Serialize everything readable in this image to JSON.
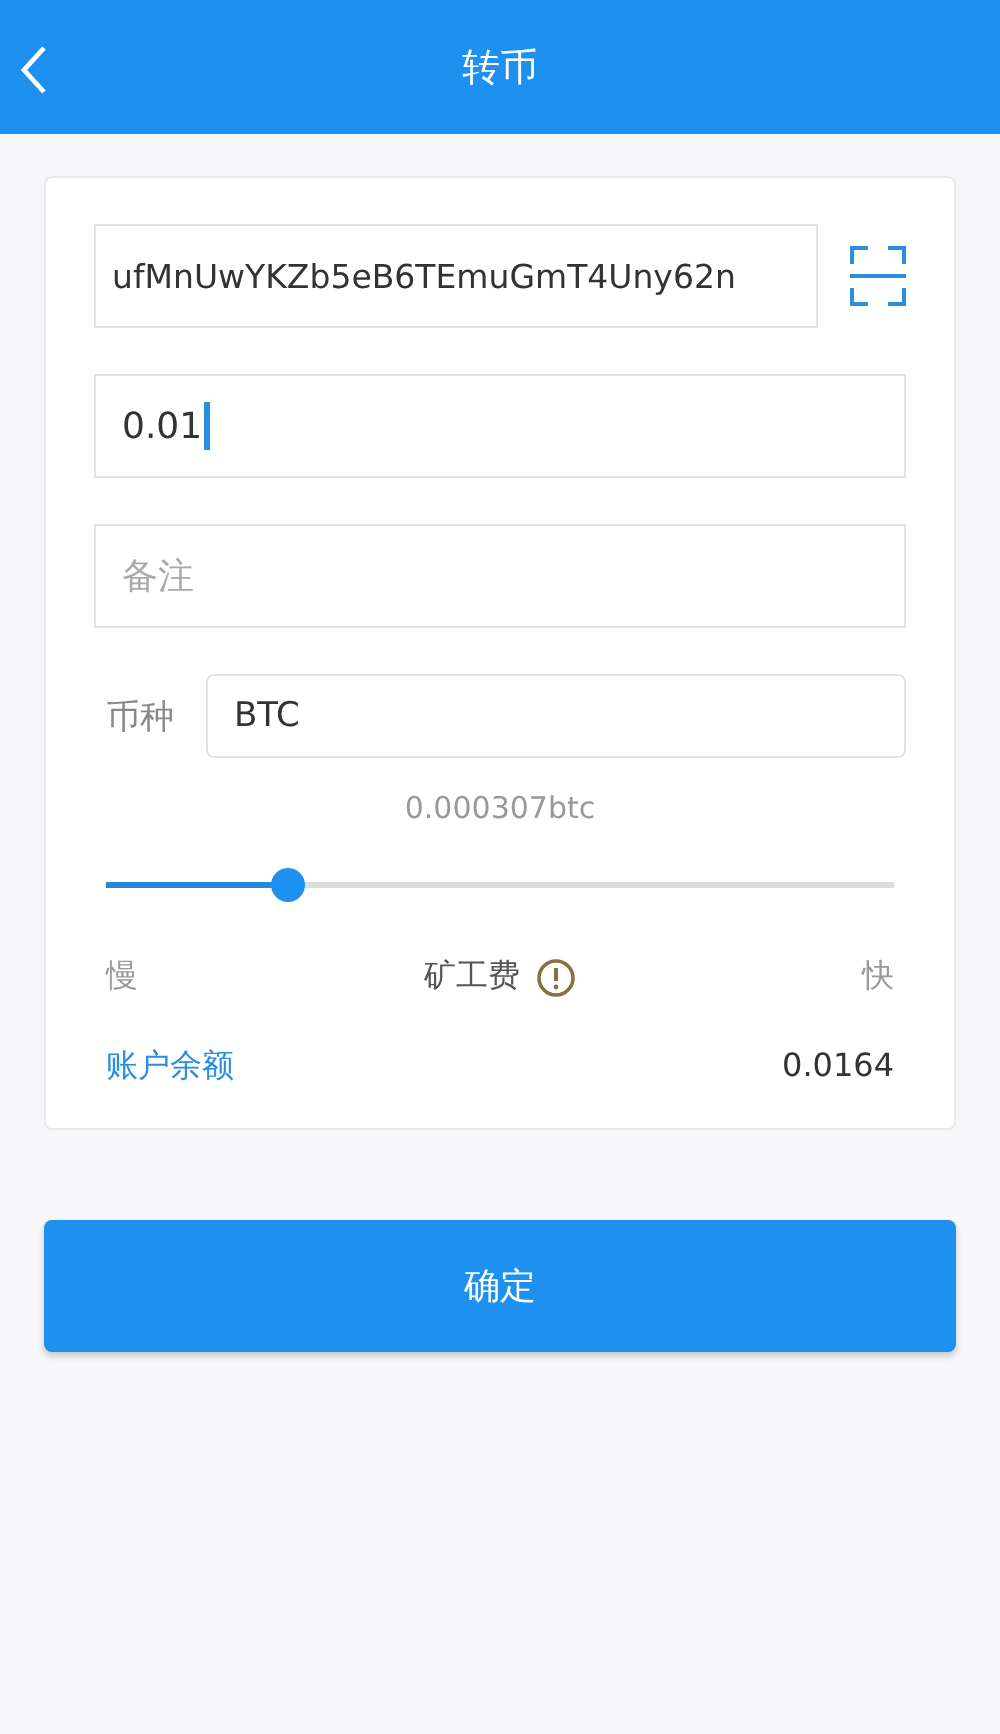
{
  "header": {
    "title": "转币"
  },
  "address": {
    "value": "ufMnUwYKZb5eB6TEmuGmT4Uny62n"
  },
  "amount": {
    "value": "0.01",
    "focused": true
  },
  "memo": {
    "placeholder": "备注"
  },
  "currency": {
    "label": "币种",
    "value": "BTC"
  },
  "fee": {
    "reading": "0.000307btc",
    "level": 0.23,
    "slow": "慢",
    "label": "矿工费",
    "fast": "快"
  },
  "balance": {
    "label": "账户余额",
    "value": "0.0164"
  },
  "confirm": "确定"
}
